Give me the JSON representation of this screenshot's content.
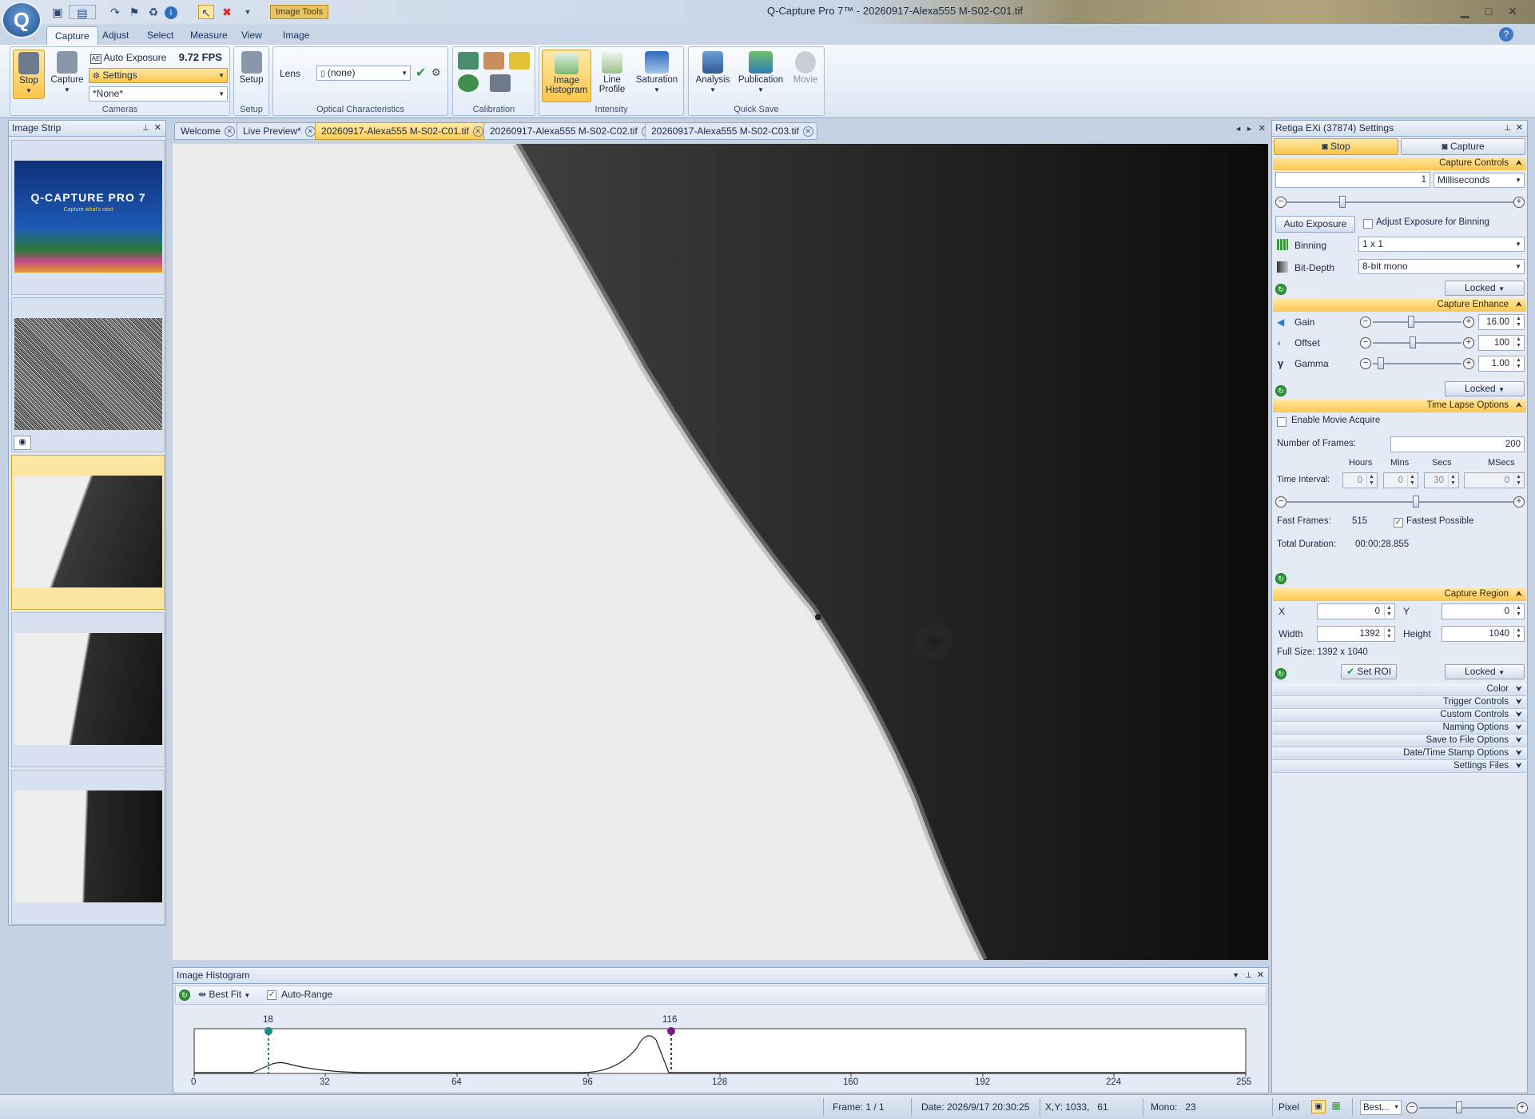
{
  "window": {
    "title": "Q-Capture Pro 7™ - 20260917-Alexa555 M-S02-C01.tif",
    "context_tab": "Image Tools"
  },
  "ribbon_tabs": [
    "Capture",
    "Adjust",
    "Select",
    "Measure",
    "View",
    "Image"
  ],
  "ribbon": {
    "cameras": {
      "label": "Cameras",
      "stop": "Stop",
      "capture": "Capture",
      "auto_exposure": "Auto Exposure",
      "fps": "9.72 FPS",
      "settings": "Settings",
      "preset": "*None*"
    },
    "setup": {
      "label": "Setup",
      "button": "Setup"
    },
    "optical": {
      "label": "Optical Characteristics",
      "lens_label": "Lens",
      "lens_value": "(none)"
    },
    "calibration": {
      "label": "Calibration"
    },
    "intensity": {
      "label": "Intensity",
      "histogram": "Image Histogram",
      "line_profile": "Line Profile",
      "saturation": "Saturation"
    },
    "quick_save": {
      "label": "Quick Save",
      "analysis": "Analysis",
      "publication": "Publication",
      "movie": "Movie"
    }
  },
  "image_strip": {
    "title": "Image Strip",
    "splash": {
      "logo": "Q-CAPTURE PRO 7",
      "tagline": "Capture what's next"
    }
  },
  "doc_tabs": [
    "Welcome",
    "Live Preview*",
    "20260917-Alexa555 M-S02-C01.tif",
    "20260917-Alexa555 M-S02-C02.tif",
    "20260917-Alexa555 M-S02-C03.tif"
  ],
  "histogram": {
    "title": "Image Histogram",
    "fit": "Best Fit",
    "auto_range": "Auto-Range",
    "low_marker": "18",
    "high_marker": "116",
    "ticks": [
      "0",
      "32",
      "64",
      "96",
      "128",
      "160",
      "192",
      "224",
      "255"
    ]
  },
  "settings": {
    "title": "Retiga EXi (37874) Settings",
    "stop": "Stop",
    "capture": "Capture",
    "capture_controls": {
      "header": "Capture Controls",
      "exposure_value": "1",
      "exposure_unit": "Milliseconds",
      "auto_exposure": "Auto Exposure",
      "adjust_binning": "Adjust Exposure for Binning",
      "binning_label": "Binning",
      "binning_value": "1 x 1",
      "bitdepth_label": "Bit-Depth",
      "bitdepth_value": "8-bit mono",
      "locked": "Locked"
    },
    "capture_enhance": {
      "header": "Capture Enhance",
      "gain_label": "Gain",
      "gain_value": "16.00",
      "offset_label": "Offset",
      "offset_value": "100",
      "gamma_label": "Gamma",
      "gamma_value": "1.00",
      "locked": "Locked"
    },
    "time_lapse": {
      "header": "Time Lapse Options",
      "enable_movie": "Enable Movie Acquire",
      "frames_label": "Number of Frames:",
      "frames_value": "200",
      "hours": "Hours",
      "mins": "Mins",
      "secs": "Secs",
      "msecs": "MSecs",
      "interval_label": "Time Interval:",
      "hours_value": "0",
      "mins_value": "0",
      "secs_value": "30",
      "msecs_value": "0",
      "fast_frames_label": "Fast Frames:",
      "fast_frames_value": "515",
      "fastest": "Fastest Possible",
      "duration_label": "Total Duration:",
      "duration_value": "00:00:28.855"
    },
    "capture_region": {
      "header": "Capture Region",
      "x_label": "X",
      "x_value": "0",
      "y_label": "Y",
      "y_value": "0",
      "width_label": "Width",
      "width_value": "1392",
      "height_label": "Height",
      "height_value": "1040",
      "full_size": "Full Size: 1392 x 1040",
      "set_roi": "Set ROI",
      "locked": "Locked"
    },
    "collapsed": [
      "Color",
      "Trigger Controls",
      "Custom Controls",
      "Naming Options",
      "Save to File Options",
      "Date/Time Stamp Options",
      "Settings Files"
    ]
  },
  "status": {
    "frame": "Frame: 1 / 1",
    "date": "Date: 2026/9/17 20:30:25",
    "xy": "X,Y: 1033,   61",
    "mono": "Mono:   23",
    "pixel": "Pixel",
    "zoom": "Best..."
  },
  "colors": {
    "accent": "#fbc64a",
    "ribbon": "#dbe6f3",
    "panel": "#e4ebf5"
  }
}
